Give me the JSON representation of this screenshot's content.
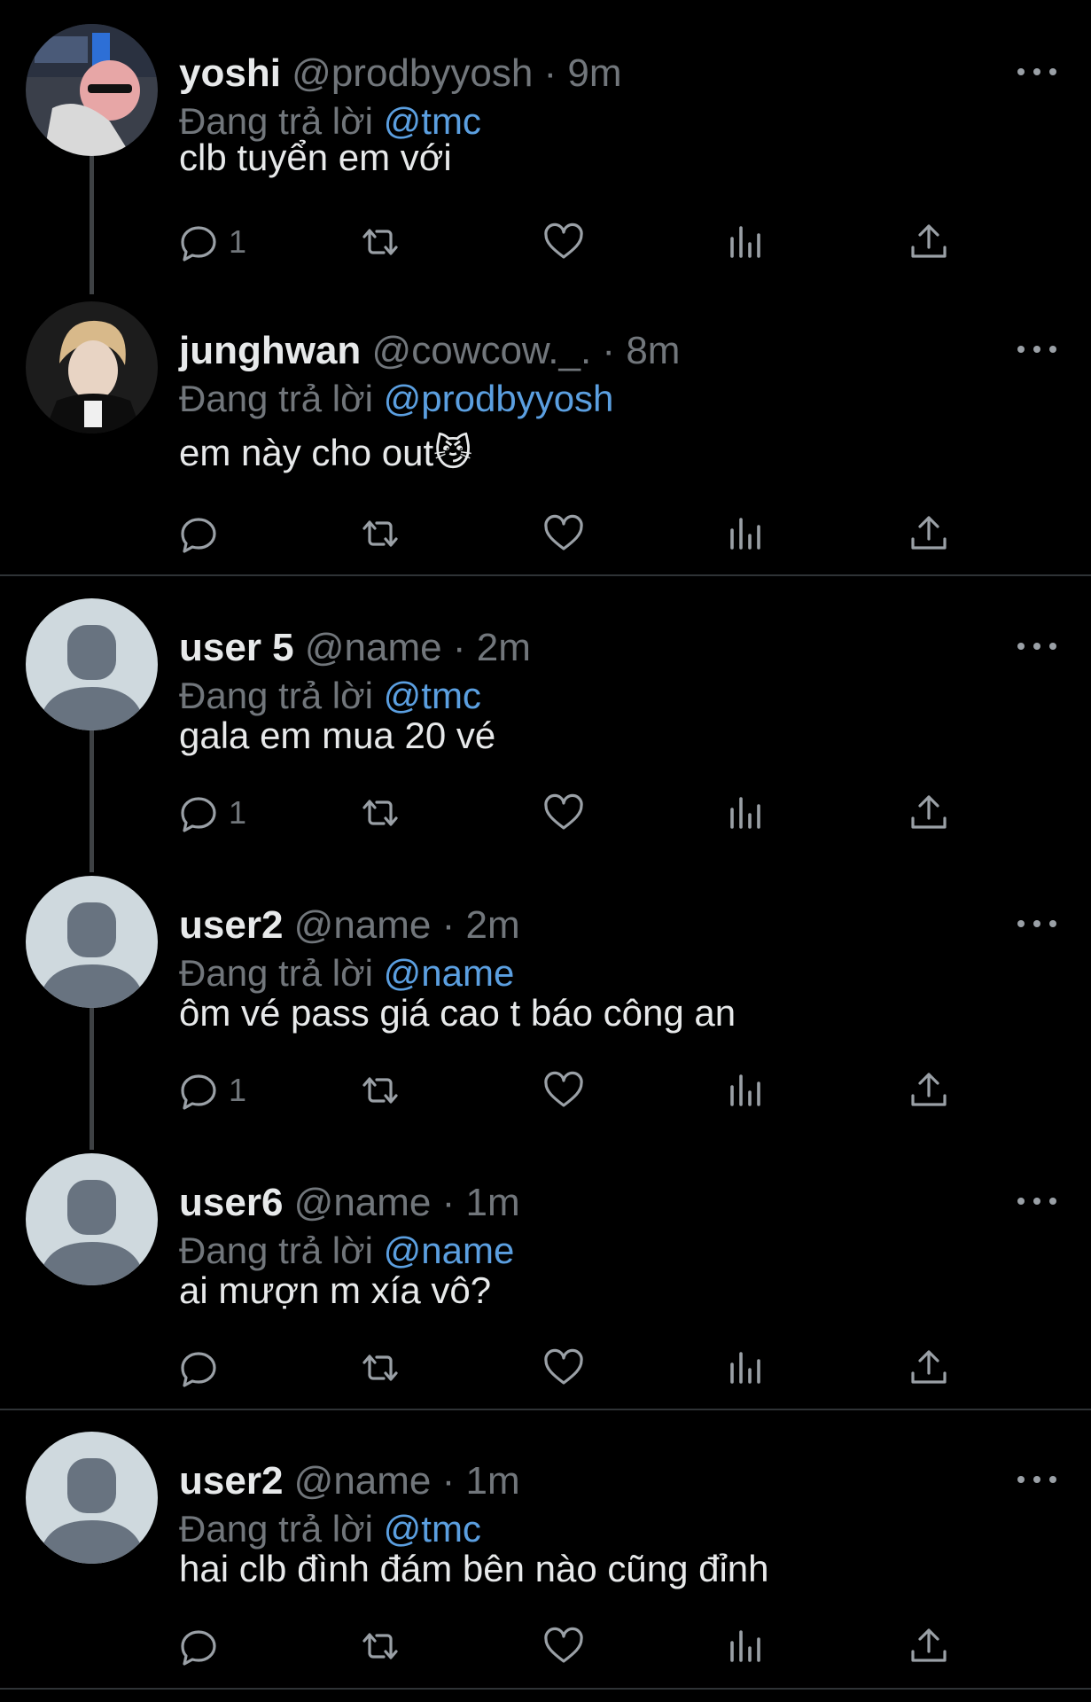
{
  "reply_prefix": "Đang trả lời",
  "tweets": [
    {
      "name": "yoshi",
      "handle": "@prodbyyosh",
      "time": "9m",
      "reply_to": "@tmc",
      "text": "clb tuyển em với",
      "replies": "1"
    },
    {
      "name": "junghwan",
      "handle": "@cowcow._.",
      "time": "8m",
      "reply_to": "@prodbyyosh",
      "text": "em này cho out😼",
      "replies": ""
    },
    {
      "name": "user 5",
      "handle": "@name",
      "time": "2m",
      "reply_to": "@tmc",
      "text": "gala em mua 20 vé",
      "replies": "1"
    },
    {
      "name": "user2",
      "handle": "@name",
      "time": "2m",
      "reply_to": "@name",
      "text": "ôm vé pass giá cao t báo công an",
      "replies": "1"
    },
    {
      "name": "user6",
      "handle": "@name",
      "time": "1m",
      "reply_to": "@name",
      "text": "ai mượn m xía vô?",
      "replies": ""
    },
    {
      "name": "user2",
      "handle": "@name",
      "time": "1m",
      "reply_to": "@tmc",
      "text": "hai clb đình đám bên nào cũng đỉnh",
      "replies": ""
    }
  ],
  "colors": {
    "background": "#000000",
    "text": "#e7e9ea",
    "muted": "#71767b",
    "link": "#5b9fe0",
    "icon": "#9aa0a6"
  },
  "icons": [
    "reply-icon",
    "retweet-icon",
    "like-icon",
    "views-icon",
    "share-icon",
    "more-icon",
    "default-avatar-icon"
  ]
}
